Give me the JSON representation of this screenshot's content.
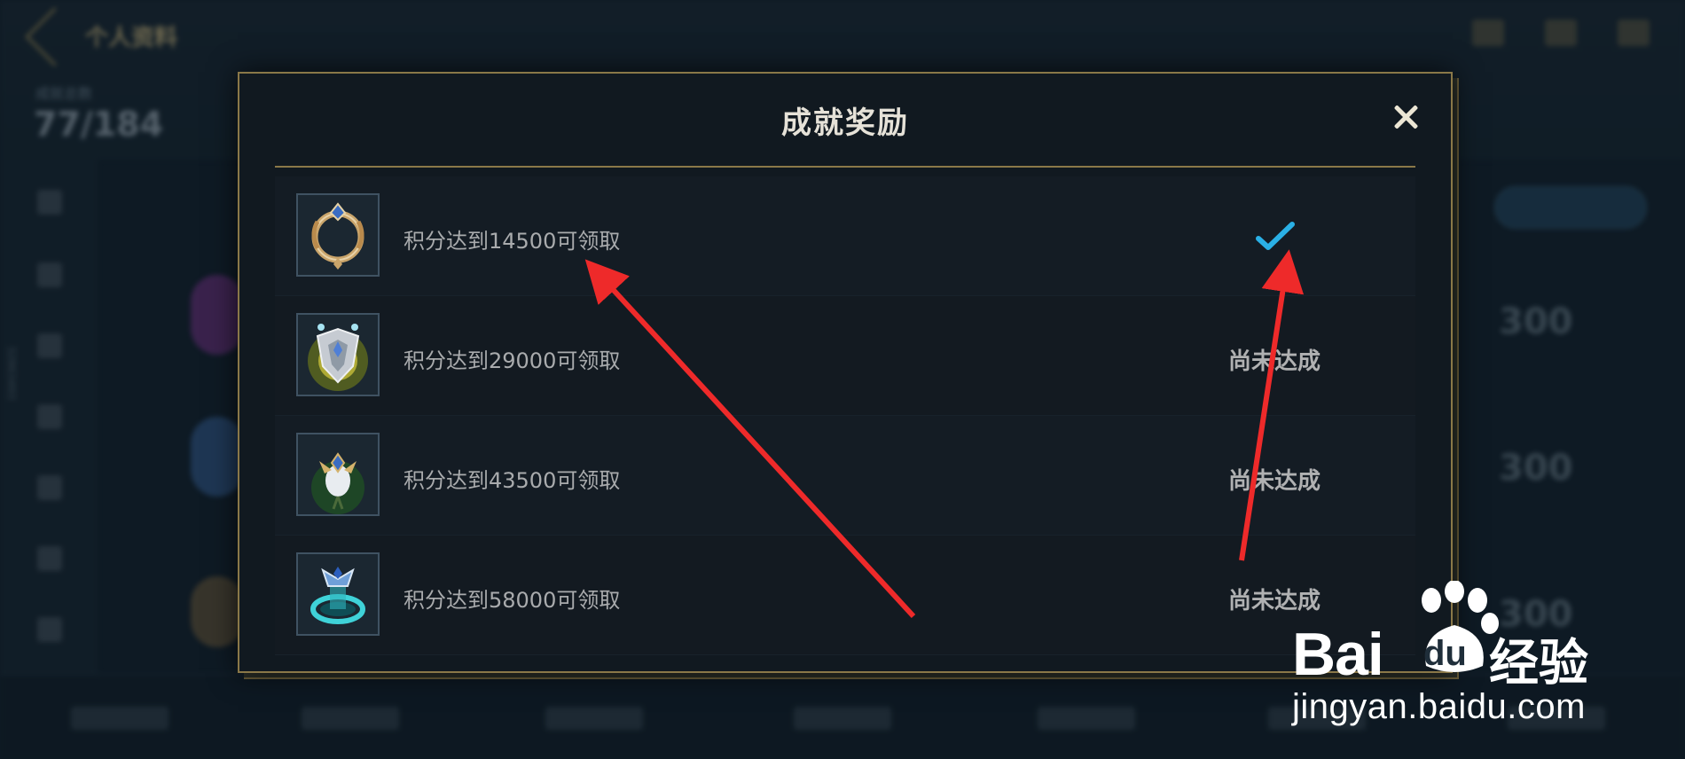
{
  "background": {
    "title": "个人资料",
    "count_label": "成就总数",
    "count": "77/184",
    "side_text": "32863493",
    "scores": [
      "300",
      "300",
      "300"
    ]
  },
  "modal": {
    "title": "成就奖励",
    "rewards": [
      {
        "label": "积分达到14500可领取",
        "status": "achieved",
        "status_icon": "checkmark-icon",
        "status_text": ""
      },
      {
        "label": "积分达到29000可领取",
        "status": "not_achieved",
        "status_text": "尚未达成"
      },
      {
        "label": "积分达到43500可领取",
        "status": "not_achieved",
        "status_text": "尚未达成"
      },
      {
        "label": "积分达到58000可领取",
        "status": "not_achieved",
        "status_text": "尚未达成"
      }
    ],
    "close_icon": "close-icon"
  },
  "watermark": {
    "brand_latin_1": "Bai",
    "brand_latin_2": "du",
    "brand_cn": "经验",
    "url": "jingyan.baidu.com"
  },
  "colors": {
    "modal_border": "#8a7848",
    "check": "#2ab0e6",
    "arrow": "#ee2a2a"
  }
}
